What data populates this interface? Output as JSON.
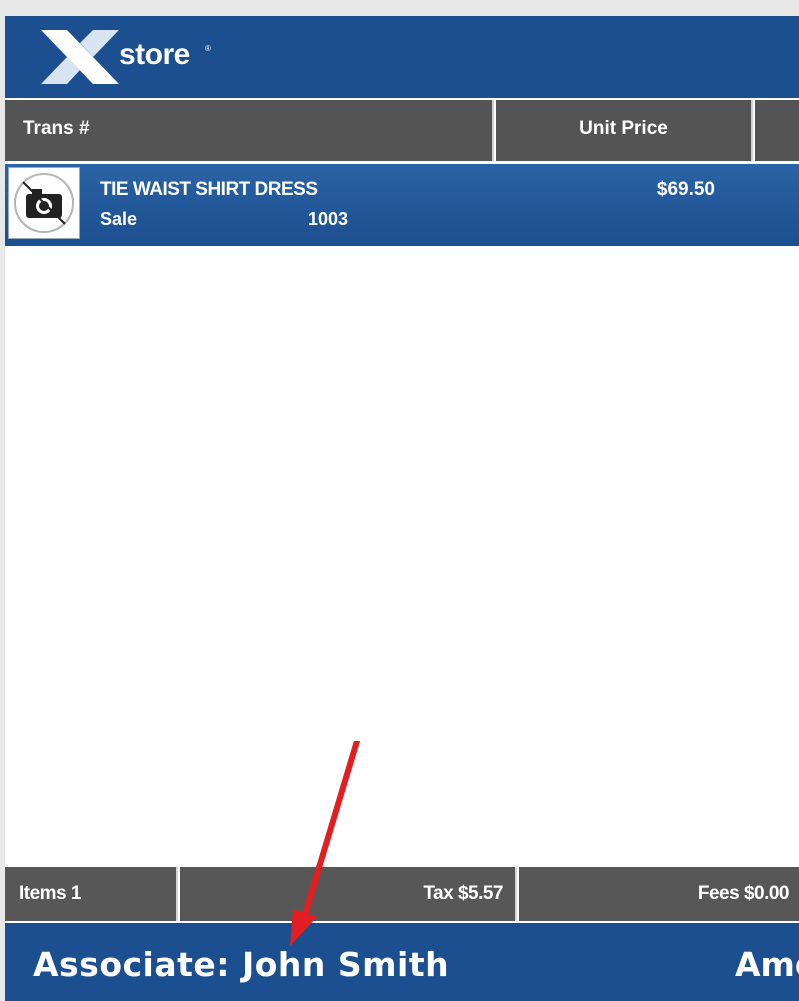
{
  "header": {
    "brand_text": "store",
    "brand_mark": "x-logo",
    "trademark": "®"
  },
  "columns": {
    "trans_label": "Trans #",
    "unit_price_label": "Unit Price"
  },
  "line_items": [
    {
      "description": "TIE WAIST SHIRT DRESS",
      "type": "Sale",
      "number": "1003",
      "price": "$69.50",
      "image": "camera-icon"
    }
  ],
  "summary": {
    "items": "Items 1",
    "tax": "Tax $5.57",
    "fees": "Fees $0.00"
  },
  "footer": {
    "associate": "Associate: John Smith",
    "amount_partial": "Amo"
  },
  "colors": {
    "brand_blue": "#1b4f8f",
    "header_gray": "#545454",
    "selected_row": "#2a63a6",
    "arrow": "#e41e20"
  }
}
